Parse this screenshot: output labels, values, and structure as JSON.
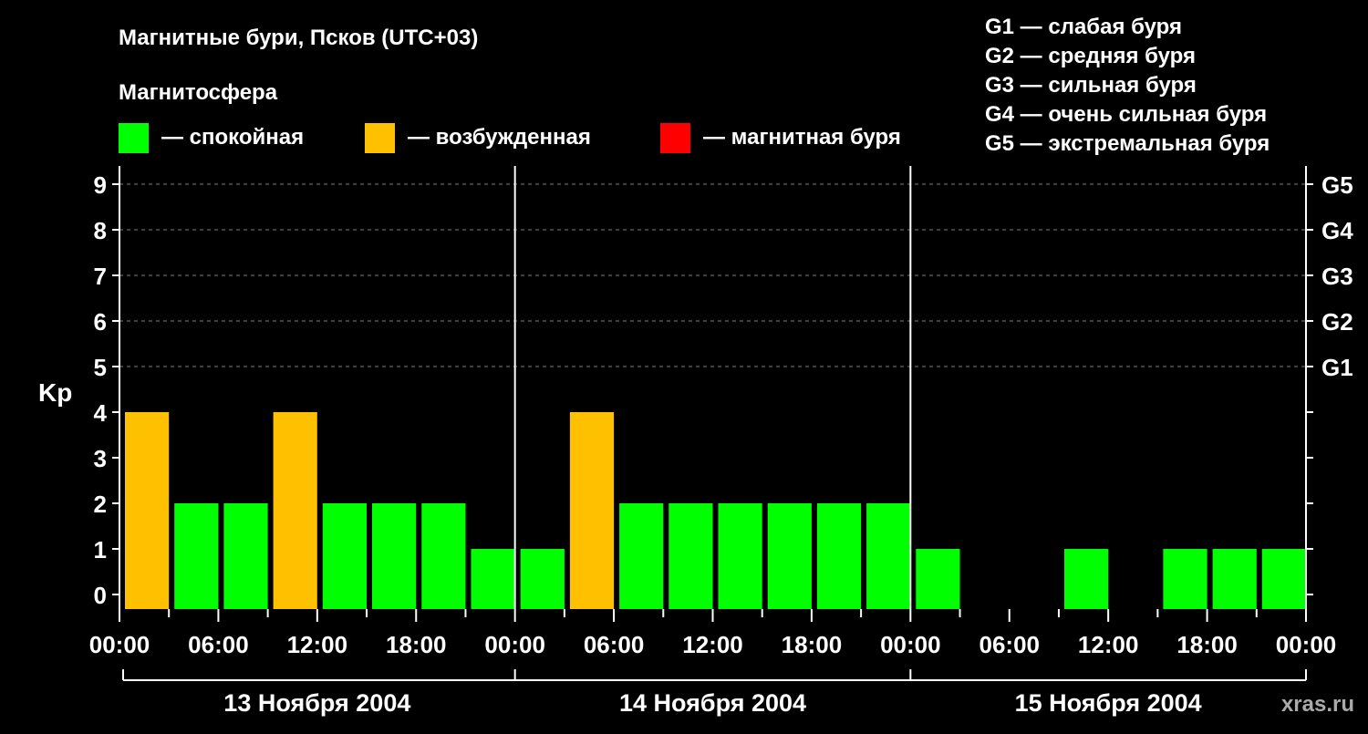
{
  "title": "Магнитные бури, Псков (UTC+03)",
  "section_label": "Магнитосфера",
  "status_legend": [
    {
      "label": "— спокойная",
      "color": "#00ff00"
    },
    {
      "label": "— возбужденная",
      "color": "#ffc000"
    },
    {
      "label": "— магнитная буря",
      "color": "#ff0000"
    }
  ],
  "storm_scale": [
    "G1 — слабая буря",
    "G2 — средняя буря",
    "G3 — сильная буря",
    "G4 — очень сильная буря",
    "G5 — экстремальная буря"
  ],
  "watermark": "xras.ru",
  "chart_data": {
    "type": "bar",
    "ylabel": "Kp",
    "ylim": [
      0,
      9
    ],
    "y_ticks": [
      "0",
      "1",
      "2",
      "3",
      "4",
      "5",
      "6",
      "7",
      "8",
      "9"
    ],
    "right_ticks": [
      {
        "kp": 5,
        "label": "G1"
      },
      {
        "kp": 6,
        "label": "G2"
      },
      {
        "kp": 7,
        "label": "G3"
      },
      {
        "kp": 8,
        "label": "G4"
      },
      {
        "kp": 9,
        "label": "G5"
      }
    ],
    "x_tick_labels": [
      "00:00",
      "06:00",
      "12:00",
      "18:00",
      "00:00",
      "06:00",
      "12:00",
      "18:00",
      "00:00",
      "06:00",
      "12:00",
      "18:00",
      "00:00"
    ],
    "days": [
      "13 Ноября 2004",
      "14 Ноября 2004",
      "15 Ноября 2004"
    ],
    "interval_hours": 3,
    "kp_values": [
      4,
      2,
      2,
      4,
      2,
      2,
      2,
      1,
      1,
      4,
      2,
      2,
      2,
      2,
      2,
      2,
      1,
      0,
      0,
      1,
      0,
      1,
      1,
      1
    ],
    "color_rule": {
      "quiet_max": 3,
      "active_max": 4
    },
    "grid": "dashed horizontal at Kp 5-9",
    "gridline_color": "#808080"
  }
}
